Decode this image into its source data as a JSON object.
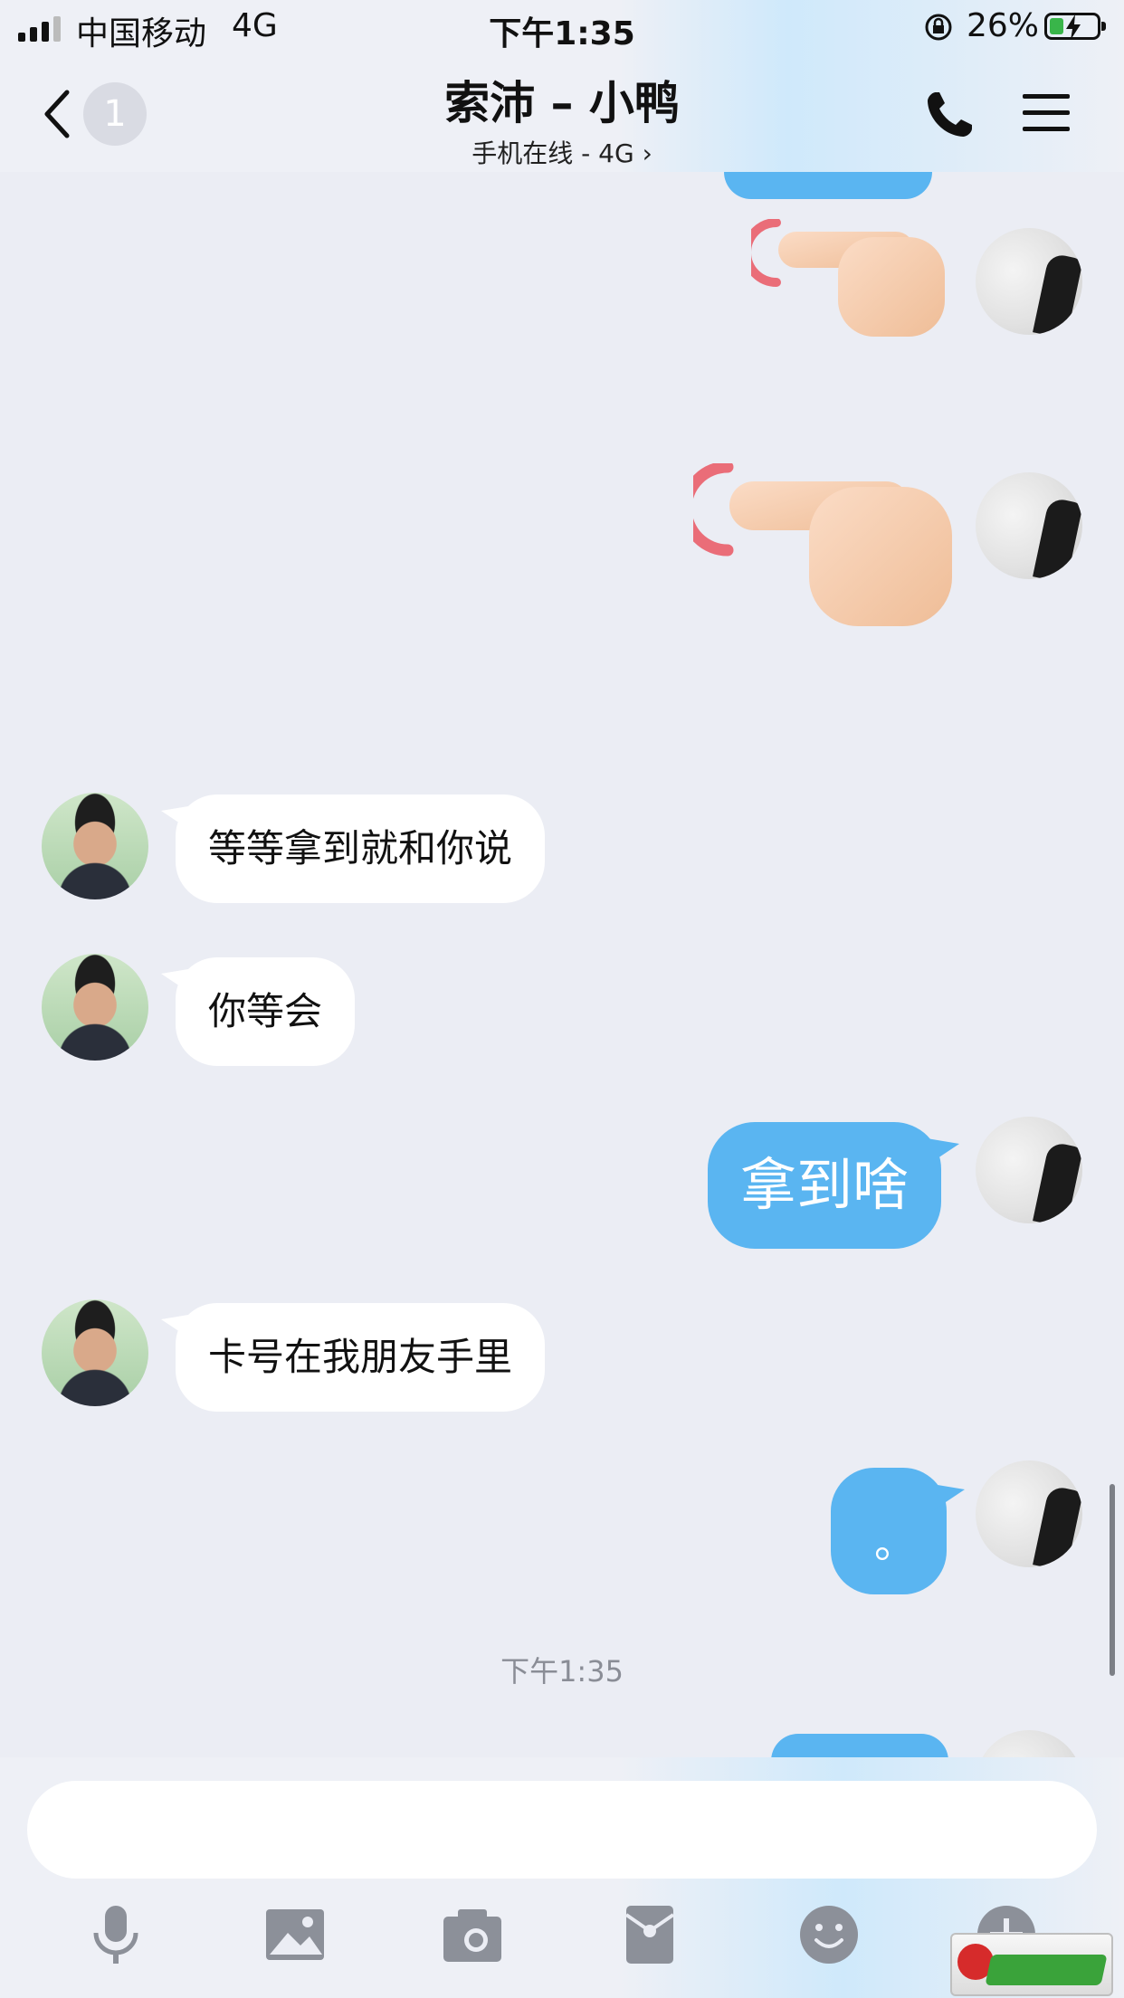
{
  "status_bar": {
    "carrier": "中国移动",
    "network": "4G",
    "time": "下午1:35",
    "battery_percent": "26%",
    "battery_level": 0.26
  },
  "nav": {
    "unread_count": "1",
    "title": "索沛 – 小鸭",
    "subtitle": "手机在线 - 4G",
    "subtitle_chevron": "›"
  },
  "messages": [
    {
      "from": "me",
      "type": "sticker",
      "sticker": "pointing-hand"
    },
    {
      "from": "me",
      "type": "sticker",
      "sticker": "pointing-hand"
    },
    {
      "from": "friend",
      "type": "text",
      "text": "等等拿到就和你说"
    },
    {
      "from": "friend",
      "type": "text",
      "text": "你等会"
    },
    {
      "from": "me",
      "type": "text",
      "text": "拿到啥"
    },
    {
      "from": "friend",
      "type": "text",
      "text": "卡号在我朋友手里"
    },
    {
      "from": "me",
      "type": "text",
      "text": "。"
    }
  ],
  "timestamp": "下午1:35",
  "toolbar": [
    "microphone-icon",
    "image-icon",
    "camera-icon",
    "red-packet-icon",
    "emoji-icon",
    "plus-icon"
  ],
  "colors": {
    "my_bubble": "#5ab5f1",
    "friend_bubble": "#ffffff",
    "background": "#ebedf4"
  }
}
